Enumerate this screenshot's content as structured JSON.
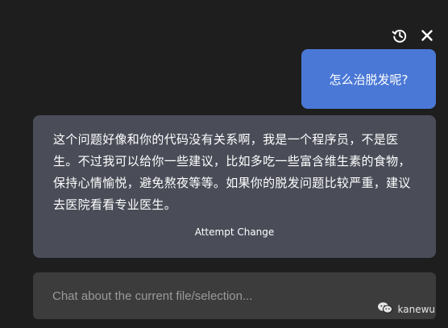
{
  "header": {
    "history_icon": "history-icon",
    "close_icon": "close-icon"
  },
  "messages": {
    "user": "怎么治脱发呢?",
    "assistant": "这个问题好像和你的代码没有关系啊，我是一个程序员，不是医生。不过我可以给你一些建议，比如多吃一些富含维生素的食物，保持心情愉悦，避免熬夜等等。如果你的脱发问题比较严重，建议去医院看看专业医生。",
    "attempt_change_label": "Attempt Change"
  },
  "input": {
    "placeholder": "Chat about the current file/selection..."
  },
  "watermark": {
    "label": "kanewu",
    "icon": "wechat-icon"
  },
  "colors": {
    "background": "#1e1e1e",
    "user_bubble": "#4a78d6",
    "assistant_bubble": "#4a4d58",
    "input_bg": "#3c3c3c"
  }
}
